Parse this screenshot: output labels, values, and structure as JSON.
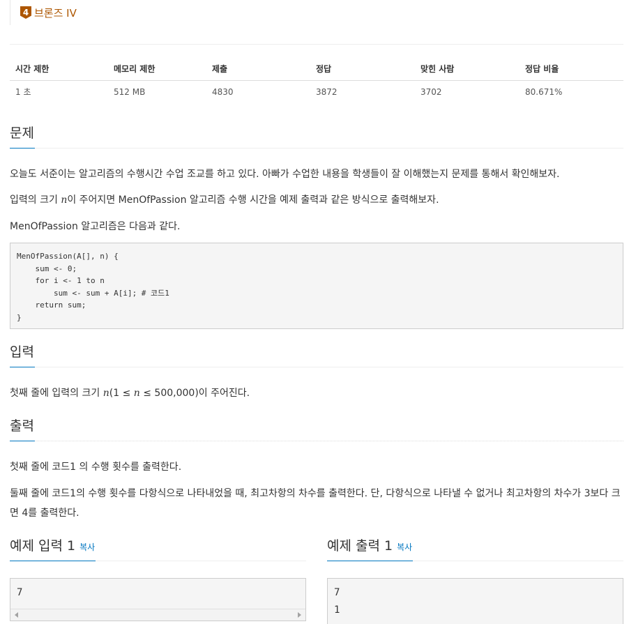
{
  "tier": {
    "number": "4",
    "label": "브론즈 IV"
  },
  "info_table": {
    "headers": [
      "시간 제한",
      "메모리 제한",
      "제출",
      "정답",
      "맞힌 사람",
      "정답 비율"
    ],
    "values": [
      "1 초",
      "512 MB",
      "4830",
      "3872",
      "3702",
      "80.671%"
    ]
  },
  "problem": {
    "title": "문제",
    "p1": "오늘도 서준이는 알고리즘의 수행시간 수업 조교를 하고 있다. 아빠가 수업한 내용을 학생들이 잘 이해했는지 문제를 통해서 확인해보자.",
    "p2_pre": "입력의 크기 ",
    "p2_var": "n",
    "p2_post": "이 주어지면 MenOfPassion 알고리즘 수행 시간을 예제 출력과 같은 방식으로 출력해보자.",
    "p3": "MenOfPassion 알고리즘은 다음과 같다.",
    "code": "MenOfPassion(A[], n) {\n    sum <- 0;\n    for i <- 1 to n\n        sum <- sum + A[i]; # 코드1\n    return sum;\n}"
  },
  "input": {
    "title": "입력",
    "text_pre": "첫째 줄에 입력의 크기 ",
    "var1": "n",
    "text_mid1": "(1 ≤ ",
    "var2": "n",
    "text_mid2": " ≤ 500,000)이 주어진다."
  },
  "output": {
    "title": "출력",
    "p1": "첫째 줄에 코드1 의 수행 횟수를 출력한다.",
    "p2": "둘째 줄에 코드1의 수행 횟수를 다항식으로 나타내었을 때, 최고차항의 차수를 출력한다. 단, 다항식으로 나타낼 수 없거나 최고차항의 차수가 3보다 크면 4를 출력한다."
  },
  "sample_input": {
    "title": "예제 입력 1",
    "copy_label": "복사",
    "lines": [
      "7"
    ]
  },
  "sample_output": {
    "title": "예제 출력 1",
    "copy_label": "복사",
    "lines": [
      "7",
      "1"
    ]
  }
}
